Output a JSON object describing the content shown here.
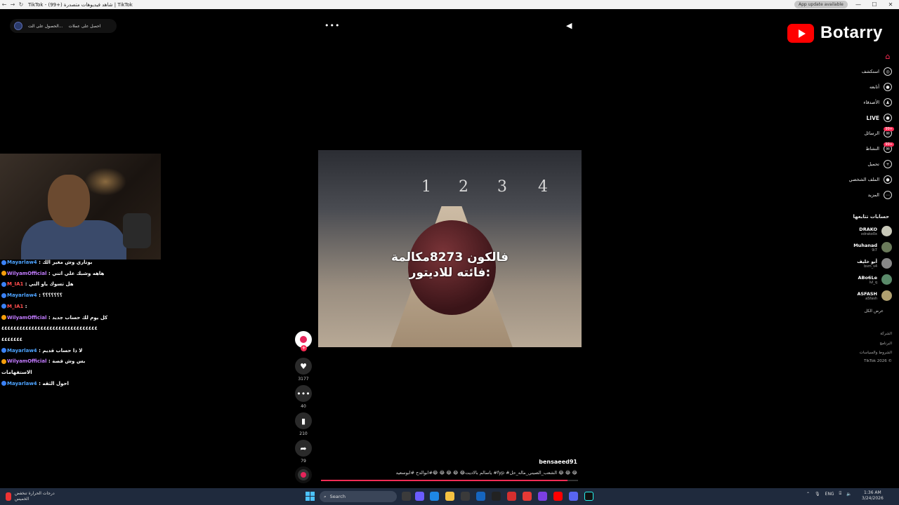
{
  "browser": {
    "tab_title": "TikTok - (99+) شاهد فيديوهات متصدرة | TikTok",
    "update_pill": "App update available",
    "nav_back": "←",
    "nav_fwd": "→",
    "nav_reload": "↻",
    "min": "—",
    "max": "☐",
    "close": "✕"
  },
  "top_controls": {
    "coins_label": "احصل على عملات",
    "app_label": "الحصول على الت..."
  },
  "chat": [
    {
      "user": "Mayarlaw4",
      "color": "blue",
      "msg": "بوتاري وش مغير الك"
    },
    {
      "user": "WilyamOfficial",
      "color": "purple",
      "msg": "هاهه وشبك علي اتني"
    },
    {
      "user": "M_IA1",
      "color": "red",
      "msg": "هل تسوك ياو الني"
    },
    {
      "user": "Mayarlaw4",
      "color": "blue",
      "msg": "؟؟؟؟؟؟؟"
    },
    {
      "user": "M_IA1",
      "color": "red",
      "msg": ""
    },
    {
      "user": "WilyamOfficial",
      "color": "purple",
      "msg": "كل يوم لك حساب جديد"
    },
    {
      "user": "",
      "color": "",
      "msg": "٤٤٤٤٤٤٤٤٤٤٤٤٤٤٤٤٤٤٤٤٤٤٤٤٤٤٤٤٤٤٤٤"
    },
    {
      "user": "",
      "color": "",
      "msg": "٤٤٤٤٤٤٤"
    },
    {
      "user": "Mayarlaw4",
      "color": "blue",
      "msg": "لا ذا حساب قديم"
    },
    {
      "user": "WilyamOfficial",
      "color": "purple",
      "msg": "بس وش قصة"
    },
    {
      "user": "",
      "color": "",
      "msg": "الاستفهامات"
    },
    {
      "user": "Mayarlaw4",
      "color": "blue",
      "msg": "احول الثقه"
    }
  ],
  "video": {
    "caption_line1": "فالكون 8273مكالمة",
    "caption_line2": "فائته للاديتور:",
    "lane_numbers": [
      "1",
      "2",
      "3",
      "4"
    ],
    "author": "bensaeed91",
    "description": "ياسالم بالاديت😂 😂 😂 😂 😂#ابوالدح #ابوسعيد #fyp #الشعب_الصيني_ماله_حل 😂 😂 😂",
    "progress_fraction": 0.96
  },
  "actions": {
    "likes": "3177",
    "comments": "40",
    "saves": "210",
    "shares": "79",
    "follow_plus": "+"
  },
  "more_icon": "•••",
  "volume_icon": "◀",
  "brand": {
    "name": "Botarry",
    "color": "#ff0000"
  },
  "sidebar": {
    "items": [
      {
        "label": "",
        "icon": "home-icon"
      },
      {
        "label": "استكشف",
        "icon": "compass-icon"
      },
      {
        "label": "أتابعه",
        "icon": "following-icon"
      },
      {
        "label": "الأصدقاء",
        "icon": "friends-icon"
      },
      {
        "label": "LIVE",
        "icon": "live-icon"
      },
      {
        "label": "الرسائل",
        "icon": "messages-icon",
        "badge": "99+"
      },
      {
        "label": "النشاط",
        "icon": "activity-icon",
        "badge": "99+"
      },
      {
        "label": "تحميل",
        "icon": "upload-icon"
      },
      {
        "label": "الملف الشخصي",
        "icon": "profile-icon"
      },
      {
        "label": "المزيد",
        "icon": "more-icon"
      }
    ],
    "following_title": "حسابات تتابعها",
    "following": [
      {
        "name": "DRAKO",
        "handle": "xdrako0x"
      },
      {
        "name": "Muhanad",
        "handle": "9i7"
      },
      {
        "name": "أبو خليف",
        "handle": "bsm_s4"
      },
      {
        "name": "ABo6Le",
        "handle": "lvl_q"
      },
      {
        "name": "ASFASH",
        "handle": "aSfash"
      }
    ],
    "see_all": "عرض الكل",
    "footer": [
      "الشركة",
      "البرنامج",
      "الشروط والسياسات",
      "TikTok 2026 ©"
    ]
  },
  "taskbar": {
    "weather_line1": "درجات الحرارة تنخفض",
    "weather_line2": "الخميس",
    "search_placeholder": "Search",
    "lang": "ENG",
    "time": "1:36 AM",
    "date": "3/24/2026"
  }
}
